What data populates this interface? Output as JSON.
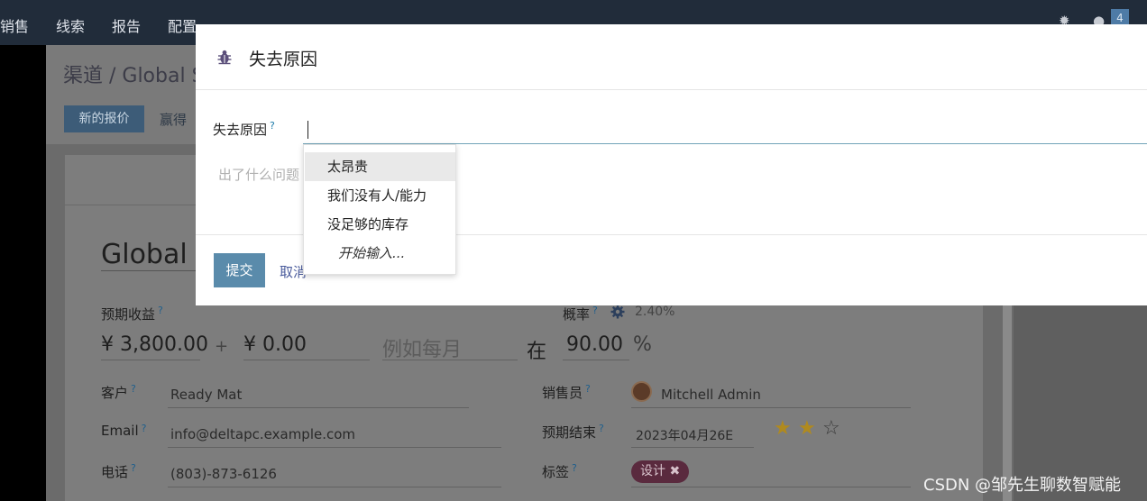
{
  "topbar": {
    "menu": [
      "销售",
      "线索",
      "报告",
      "配置"
    ],
    "notification_count": "4"
  },
  "breadcrumb": "渠道 / Global S",
  "actions": {
    "new_quote": "新的报价",
    "won": "赢得"
  },
  "record": {
    "title": "Global",
    "expected_revenue_label": "预期收益",
    "expected_revenue": "¥ 3,800.00",
    "plus": "+",
    "recurring_revenue": "¥ 0.00",
    "recurring_placeholder": "例如每月",
    "at": "在",
    "probability_label": "概率",
    "probability_value": "90.00",
    "percent": "%",
    "auto_probability": "2.40%",
    "customer_label": "客户",
    "customer": "Ready Mat",
    "email_label": "Email",
    "email": "info@deltapc.example.com",
    "phone_label": "电话",
    "phone": "(803)-873-6126",
    "salesperson_label": "销售员",
    "salesperson": "Mitchell Admin",
    "deadline_label": "预期结束",
    "deadline": "2023年04月26E",
    "priority_stars": 2,
    "priority_max": 3,
    "tags_label": "标签",
    "tag": "设计 ✖"
  },
  "modal": {
    "title": "失去原因",
    "field_label": "失去原因",
    "help_mark": "?",
    "input_value": "",
    "feedback_placeholder": "出了什么问题",
    "submit": "提交",
    "cancel": "取消"
  },
  "dropdown": {
    "items": [
      "太昂贵",
      "我们没有人/能力",
      "没足够的库存"
    ],
    "search_more": "开始输入..."
  },
  "watermark": "CSDN @邹先生聊数智赋能"
}
